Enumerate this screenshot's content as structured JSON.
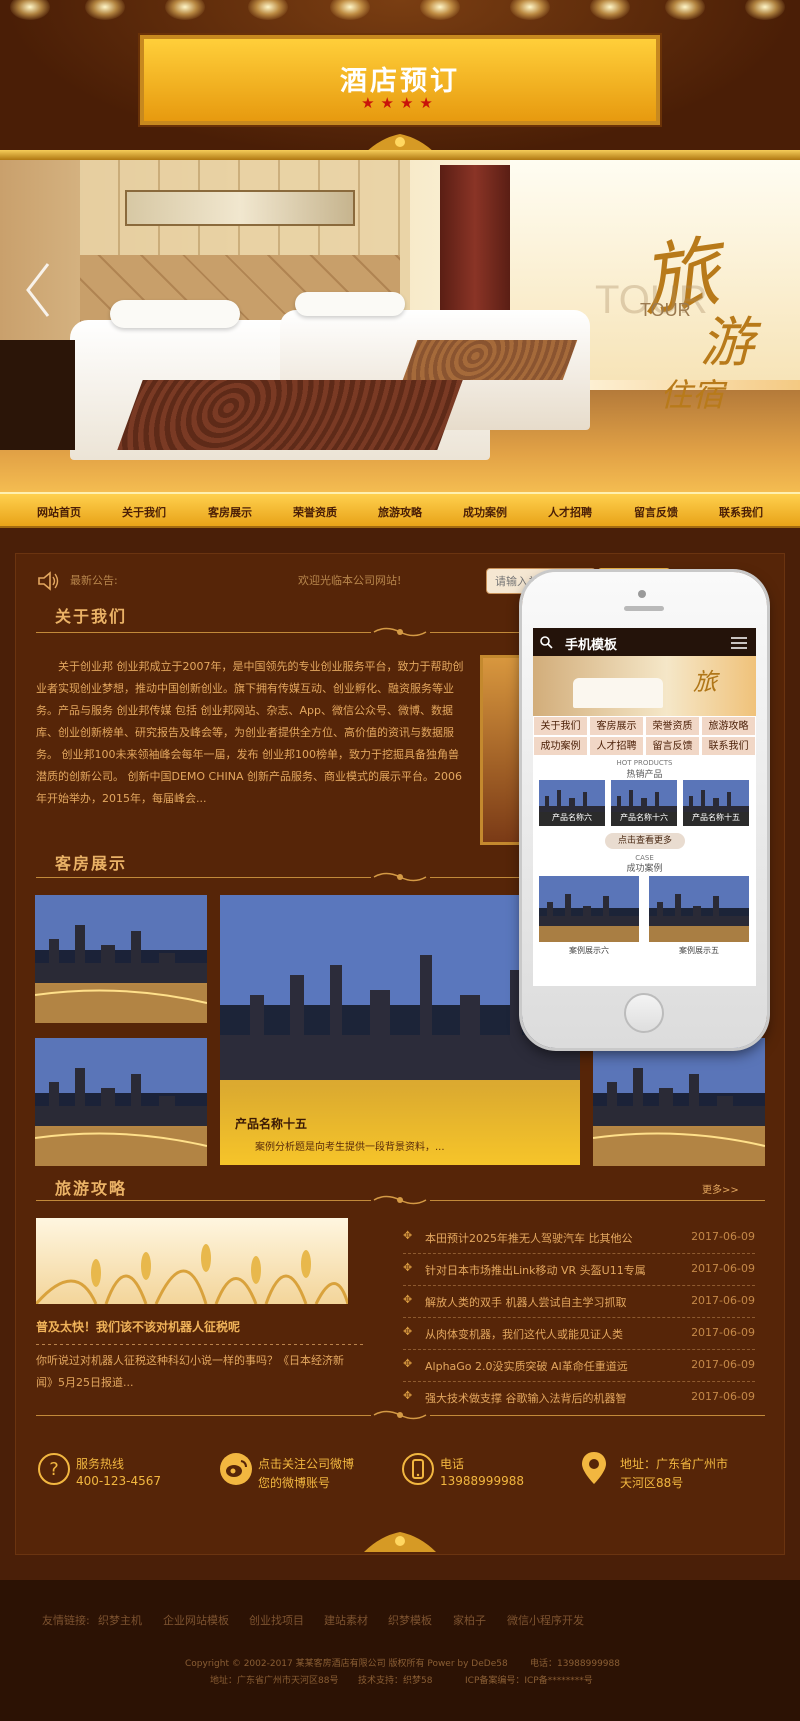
{
  "header": {
    "title": "酒店预订",
    "stars": "★★★★"
  },
  "banner": {
    "calligraphy_1": "旅",
    "calligraphy_2": "游",
    "calligraphy_3": "住宿",
    "tour_big": "TOUR",
    "tour_small": "TOUR"
  },
  "nav": [
    "网站首页",
    "关于我们",
    "客房展示",
    "荣誉资质",
    "旅游攻略",
    "成功案例",
    "人才招聘",
    "留言反馈",
    "联系我们"
  ],
  "notice": {
    "label": "最新公告:",
    "text": "欢迎光临本公司网站!",
    "search_placeholder": "请输入关"
  },
  "about": {
    "title": "关于我们",
    "paragraph": "关于创业邦 创业邦成立于2007年，是中国领先的专业创业服务平台，致力于帮助创业者实现创业梦想，推动中国创新创业。旗下拥有传媒互动、创业孵化、融资服务等业务。产品与服务 创业邦传媒 包括 创业邦网站、杂志、App、微信公众号、微博、数据库、创业创新榜单、研究报告及峰会等，为创业者提供全方位、高价值的资讯与数据服务。 创业邦100未来领袖峰会每年一届，发布 创业邦100榜单，致力于挖掘具备独角兽潜质的创新公司。 创新中国DEMO CHINA 创新产品服务、商业模式的展示平台。2006年开始举办，2015年，每届峰会..."
  },
  "rooms": {
    "title": "客房展示",
    "featured_title": "产品名称十五",
    "featured_desc": "案例分析题是向考生提供一段背景资料，..."
  },
  "travel": {
    "title": "旅游攻略",
    "more": "更多>>",
    "feature_title": "普及太快！我们该不该对机器人征税呢",
    "feature_desc": "你听说过对机器人征税这种科幻小说一样的事吗？《日本经济新闻》5月25日报道...",
    "news": [
      {
        "title": "本田预计2025年推无人驾驶汽车 比其他公",
        "date": "2017-06-09"
      },
      {
        "title": "针对日本市场推出Link移动 VR 头盔U11专属",
        "date": "2017-06-09"
      },
      {
        "title": "解放人类的双手 机器人尝试自主学习抓取",
        "date": "2017-06-09"
      },
      {
        "title": "从肉体变机器，我们这代人或能见证人类",
        "date": "2017-06-09"
      },
      {
        "title": "AlphaGo 2.0没实质突破 AI革命任重道远",
        "date": "2017-06-09"
      },
      {
        "title": "强大技术做支撑 谷歌输入法背后的机器智",
        "date": "2017-06-09"
      }
    ]
  },
  "contact": [
    {
      "label": "服务热线",
      "value": "400-123-4567",
      "icon": "question-icon"
    },
    {
      "label": "点击关注公司微博",
      "value": "您的微博账号",
      "icon": "weibo-icon"
    },
    {
      "label": "电话",
      "value": "13988999988",
      "icon": "phone-icon"
    },
    {
      "label": "地址：广东省广州市",
      "value": "天河区88号",
      "icon": "location-pin-icon"
    }
  ],
  "phone": {
    "title": "手机模板",
    "nav": [
      "关于我们",
      "客房展示",
      "荣誉资质",
      "旅游攻略",
      "成功案例",
      "人才招聘",
      "留言反馈",
      "联系我们"
    ],
    "hot_en": "HOT PRODUCTS",
    "hot_cn": "热销产品",
    "products": [
      "产品名称六",
      "产品名称十六",
      "产品名称十五"
    ],
    "more_button": "点击查看更多",
    "case_en": "CASE",
    "case_cn": "成功案例",
    "cases": [
      "案例展示六",
      "案例展示五"
    ]
  },
  "footer": {
    "links_label": "友情链接:",
    "links": [
      "织梦主机",
      "企业网站模板",
      "创业找项目",
      "建站素材",
      "织梦模板",
      "家柏子",
      "微信小程序开发"
    ],
    "copyright_1": "Copyright © 2002-2017 某某客房酒店有限公司 版权所有 Power by DeDe58",
    "phone_1": "电话：13988999988",
    "address_1": "地址：广东省广州市天河区88号",
    "support_1": "技术支持：织梦58",
    "icp_1": "ICP备案编号：ICP备********号"
  },
  "colors": {
    "brown_bg": "#4a1f08",
    "panel": "#562508",
    "gold": "#f7c02e",
    "text_gold": "#e3a75f",
    "phone_dark": "#24130a"
  }
}
